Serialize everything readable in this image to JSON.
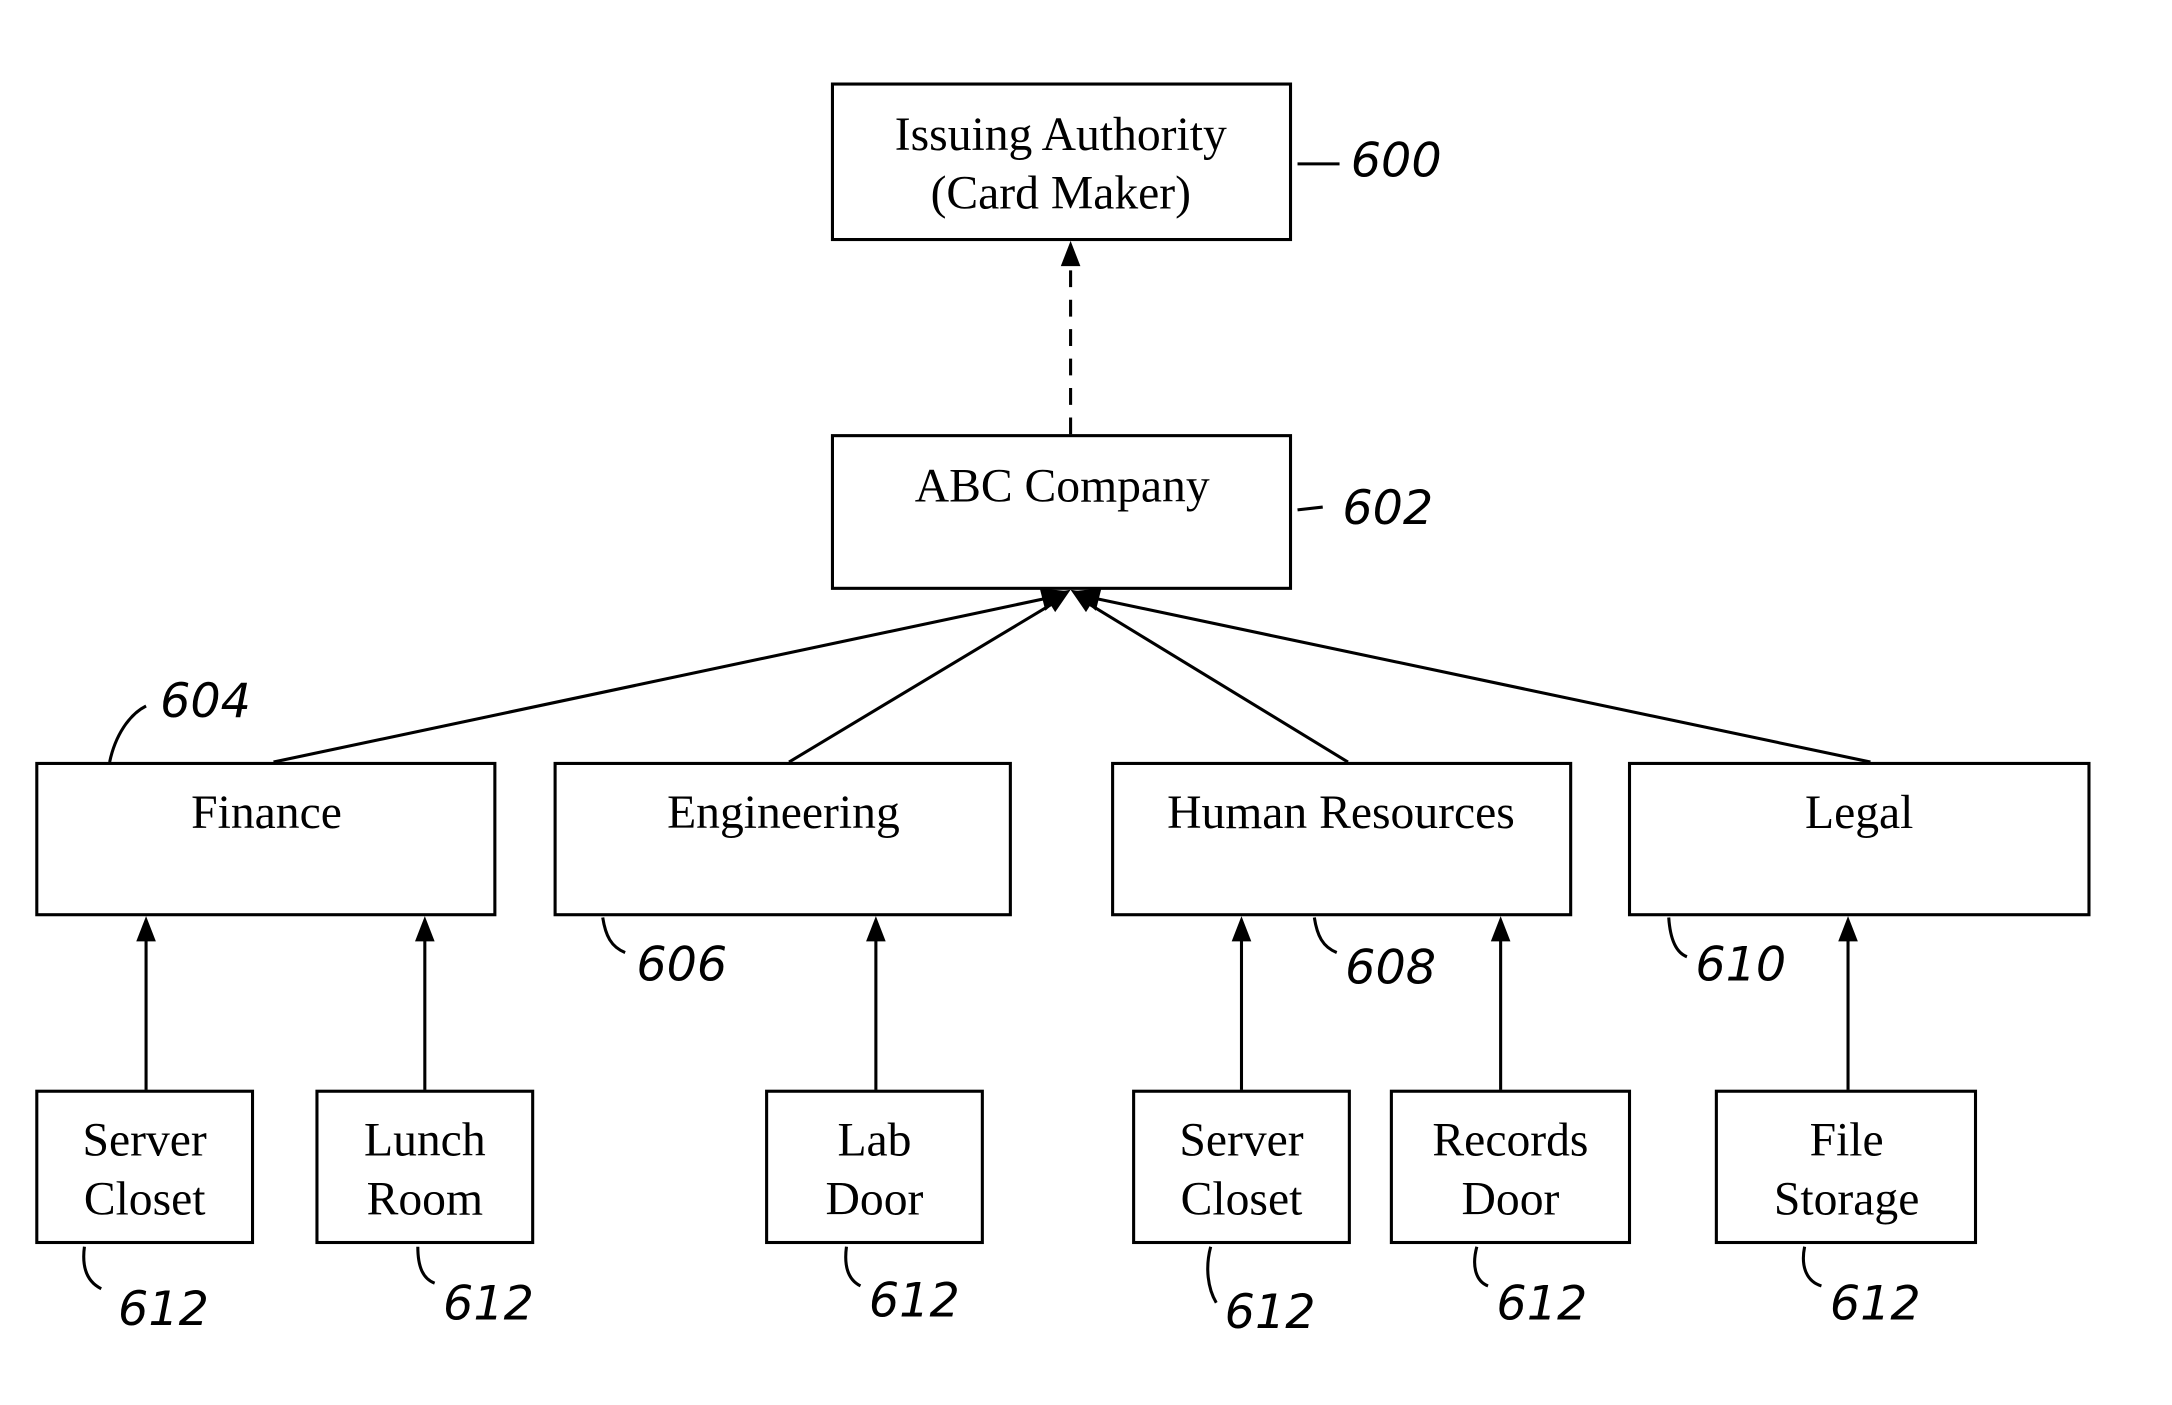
{
  "diagram": {
    "nodes": {
      "issuing_authority": {
        "line1": "Issuing Authority",
        "line2": "(Card Maker)",
        "ref": "600"
      },
      "company": {
        "line1": "ABC Company",
        "ref": "602"
      },
      "finance": {
        "line1": "Finance",
        "ref": "604"
      },
      "engineering": {
        "line1": "Engineering",
        "ref": "606"
      },
      "hr": {
        "line1": "Human Resources",
        "ref": "608"
      },
      "legal": {
        "line1": "Legal",
        "ref": "610"
      },
      "fin_server": {
        "line1": "Server",
        "line2": "Closet",
        "ref": "612"
      },
      "fin_lunch": {
        "line1": "Lunch",
        "line2": "Room",
        "ref": "612"
      },
      "eng_lab": {
        "line1": "Lab",
        "line2": "Door",
        "ref": "612"
      },
      "hr_server": {
        "line1": "Server",
        "line2": "Closet",
        "ref": "612"
      },
      "hr_records": {
        "line1": "Records",
        "line2": "Door",
        "ref": "612"
      },
      "legal_file": {
        "line1": "File",
        "line2": "Storage",
        "ref": "612"
      }
    },
    "edges": [
      {
        "from": "company",
        "to": "issuing_authority",
        "style": "dashed"
      },
      {
        "from": "finance",
        "to": "company",
        "style": "solid"
      },
      {
        "from": "engineering",
        "to": "company",
        "style": "solid"
      },
      {
        "from": "hr",
        "to": "company",
        "style": "solid"
      },
      {
        "from": "legal",
        "to": "company",
        "style": "solid"
      },
      {
        "from": "fin_server",
        "to": "finance",
        "style": "solid"
      },
      {
        "from": "fin_lunch",
        "to": "finance",
        "style": "solid"
      },
      {
        "from": "eng_lab",
        "to": "engineering",
        "style": "solid"
      },
      {
        "from": "hr_server",
        "to": "hr",
        "style": "solid"
      },
      {
        "from": "hr_records",
        "to": "hr",
        "style": "solid"
      },
      {
        "from": "legal_file",
        "to": "legal",
        "style": "solid"
      }
    ]
  }
}
